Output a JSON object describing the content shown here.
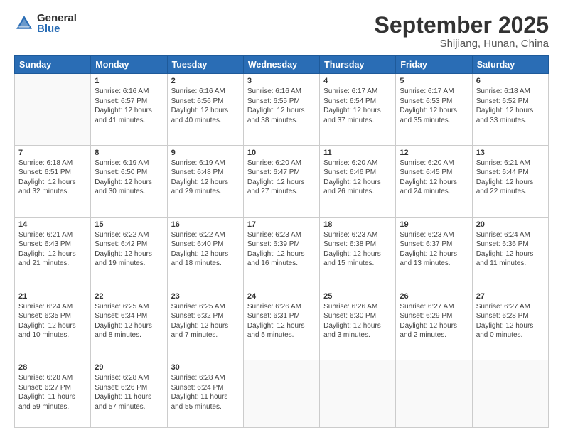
{
  "logo": {
    "general": "General",
    "blue": "Blue"
  },
  "header": {
    "month": "September 2025",
    "location": "Shijiang, Hunan, China"
  },
  "weekdays": [
    "Sunday",
    "Monday",
    "Tuesday",
    "Wednesday",
    "Thursday",
    "Friday",
    "Saturday"
  ],
  "weeks": [
    [
      {
        "day": "",
        "info": ""
      },
      {
        "day": "1",
        "info": "Sunrise: 6:16 AM\nSunset: 6:57 PM\nDaylight: 12 hours\nand 41 minutes."
      },
      {
        "day": "2",
        "info": "Sunrise: 6:16 AM\nSunset: 6:56 PM\nDaylight: 12 hours\nand 40 minutes."
      },
      {
        "day": "3",
        "info": "Sunrise: 6:16 AM\nSunset: 6:55 PM\nDaylight: 12 hours\nand 38 minutes."
      },
      {
        "day": "4",
        "info": "Sunrise: 6:17 AM\nSunset: 6:54 PM\nDaylight: 12 hours\nand 37 minutes."
      },
      {
        "day": "5",
        "info": "Sunrise: 6:17 AM\nSunset: 6:53 PM\nDaylight: 12 hours\nand 35 minutes."
      },
      {
        "day": "6",
        "info": "Sunrise: 6:18 AM\nSunset: 6:52 PM\nDaylight: 12 hours\nand 33 minutes."
      }
    ],
    [
      {
        "day": "7",
        "info": "Sunrise: 6:18 AM\nSunset: 6:51 PM\nDaylight: 12 hours\nand 32 minutes."
      },
      {
        "day": "8",
        "info": "Sunrise: 6:19 AM\nSunset: 6:50 PM\nDaylight: 12 hours\nand 30 minutes."
      },
      {
        "day": "9",
        "info": "Sunrise: 6:19 AM\nSunset: 6:48 PM\nDaylight: 12 hours\nand 29 minutes."
      },
      {
        "day": "10",
        "info": "Sunrise: 6:20 AM\nSunset: 6:47 PM\nDaylight: 12 hours\nand 27 minutes."
      },
      {
        "day": "11",
        "info": "Sunrise: 6:20 AM\nSunset: 6:46 PM\nDaylight: 12 hours\nand 26 minutes."
      },
      {
        "day": "12",
        "info": "Sunrise: 6:20 AM\nSunset: 6:45 PM\nDaylight: 12 hours\nand 24 minutes."
      },
      {
        "day": "13",
        "info": "Sunrise: 6:21 AM\nSunset: 6:44 PM\nDaylight: 12 hours\nand 22 minutes."
      }
    ],
    [
      {
        "day": "14",
        "info": "Sunrise: 6:21 AM\nSunset: 6:43 PM\nDaylight: 12 hours\nand 21 minutes."
      },
      {
        "day": "15",
        "info": "Sunrise: 6:22 AM\nSunset: 6:42 PM\nDaylight: 12 hours\nand 19 minutes."
      },
      {
        "day": "16",
        "info": "Sunrise: 6:22 AM\nSunset: 6:40 PM\nDaylight: 12 hours\nand 18 minutes."
      },
      {
        "day": "17",
        "info": "Sunrise: 6:23 AM\nSunset: 6:39 PM\nDaylight: 12 hours\nand 16 minutes."
      },
      {
        "day": "18",
        "info": "Sunrise: 6:23 AM\nSunset: 6:38 PM\nDaylight: 12 hours\nand 15 minutes."
      },
      {
        "day": "19",
        "info": "Sunrise: 6:23 AM\nSunset: 6:37 PM\nDaylight: 12 hours\nand 13 minutes."
      },
      {
        "day": "20",
        "info": "Sunrise: 6:24 AM\nSunset: 6:36 PM\nDaylight: 12 hours\nand 11 minutes."
      }
    ],
    [
      {
        "day": "21",
        "info": "Sunrise: 6:24 AM\nSunset: 6:35 PM\nDaylight: 12 hours\nand 10 minutes."
      },
      {
        "day": "22",
        "info": "Sunrise: 6:25 AM\nSunset: 6:34 PM\nDaylight: 12 hours\nand 8 minutes."
      },
      {
        "day": "23",
        "info": "Sunrise: 6:25 AM\nSunset: 6:32 PM\nDaylight: 12 hours\nand 7 minutes."
      },
      {
        "day": "24",
        "info": "Sunrise: 6:26 AM\nSunset: 6:31 PM\nDaylight: 12 hours\nand 5 minutes."
      },
      {
        "day": "25",
        "info": "Sunrise: 6:26 AM\nSunset: 6:30 PM\nDaylight: 12 hours\nand 3 minutes."
      },
      {
        "day": "26",
        "info": "Sunrise: 6:27 AM\nSunset: 6:29 PM\nDaylight: 12 hours\nand 2 minutes."
      },
      {
        "day": "27",
        "info": "Sunrise: 6:27 AM\nSunset: 6:28 PM\nDaylight: 12 hours\nand 0 minutes."
      }
    ],
    [
      {
        "day": "28",
        "info": "Sunrise: 6:28 AM\nSunset: 6:27 PM\nDaylight: 11 hours\nand 59 minutes."
      },
      {
        "day": "29",
        "info": "Sunrise: 6:28 AM\nSunset: 6:26 PM\nDaylight: 11 hours\nand 57 minutes."
      },
      {
        "day": "30",
        "info": "Sunrise: 6:28 AM\nSunset: 6:24 PM\nDaylight: 11 hours\nand 55 minutes."
      },
      {
        "day": "",
        "info": ""
      },
      {
        "day": "",
        "info": ""
      },
      {
        "day": "",
        "info": ""
      },
      {
        "day": "",
        "info": ""
      }
    ]
  ]
}
